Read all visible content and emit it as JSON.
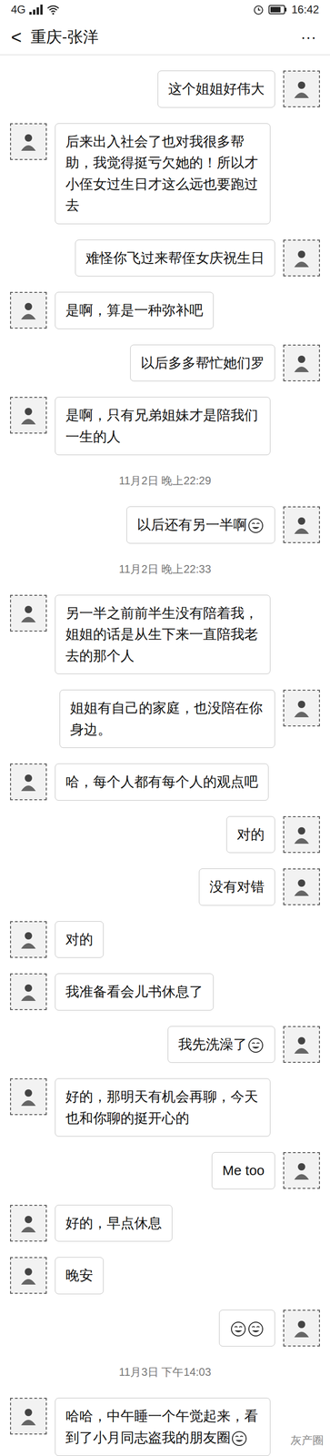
{
  "status_bar": {
    "network": "4G",
    "time": "16:42"
  },
  "header": {
    "back": "<",
    "title": "重庆-张洋",
    "more": "···"
  },
  "messages": [
    {
      "kind": "message",
      "side": "right",
      "text": "这个姐姐好伟大",
      "emojis": 0
    },
    {
      "kind": "message",
      "side": "left",
      "text": "后来出入社会了也对我很多帮助，我觉得挺亏欠她的！所以才小侄女过生日才这么远也要跑过去",
      "emojis": 0
    },
    {
      "kind": "message",
      "side": "right",
      "text": "难怪你飞过来帮侄女庆祝生日",
      "emojis": 0
    },
    {
      "kind": "message",
      "side": "left",
      "text": "是啊，算是一种弥补吧",
      "emojis": 0
    },
    {
      "kind": "message",
      "side": "right",
      "text": "以后多多帮忙她们罗",
      "emojis": 0
    },
    {
      "kind": "message",
      "side": "left",
      "text": "是啊，只有兄弟姐妹才是陪我们一生的人",
      "emojis": 0
    },
    {
      "kind": "time",
      "text": "11月2日 晚上22:29"
    },
    {
      "kind": "message",
      "side": "right",
      "text": "以后还有另一半啊",
      "emojis": 1
    },
    {
      "kind": "time",
      "text": "11月2日 晚上22:33"
    },
    {
      "kind": "message",
      "side": "left",
      "text": "另一半之前前半生没有陪着我，姐姐的话是从生下来一直陪我老去的那个人",
      "emojis": 0
    },
    {
      "kind": "message",
      "side": "right",
      "text": "姐姐有自己的家庭，也没陪在你身边。",
      "emojis": 0
    },
    {
      "kind": "message",
      "side": "left",
      "text": "哈，每个人都有每个人的观点吧",
      "emojis": 0
    },
    {
      "kind": "message",
      "side": "right",
      "text": "对的",
      "emojis": 0
    },
    {
      "kind": "message",
      "side": "right",
      "text": "没有对错",
      "emojis": 0
    },
    {
      "kind": "message",
      "side": "left",
      "text": "对的",
      "emojis": 0
    },
    {
      "kind": "message",
      "side": "left",
      "text": "我准备看会儿书休息了",
      "emojis": 0
    },
    {
      "kind": "message",
      "side": "right",
      "text": "我先洗澡了",
      "emojis": 1
    },
    {
      "kind": "message",
      "side": "left",
      "text": "好的，那明天有机会再聊，今天也和你聊的挺开心的",
      "emojis": 0
    },
    {
      "kind": "message",
      "side": "right",
      "text": "Me too",
      "emojis": 0
    },
    {
      "kind": "message",
      "side": "left",
      "text": "好的，早点休息",
      "emojis": 0
    },
    {
      "kind": "message",
      "side": "left",
      "text": "晚安",
      "emojis": 0
    },
    {
      "kind": "message",
      "side": "right",
      "text": "",
      "emojis": 2
    },
    {
      "kind": "time",
      "text": "11月3日 下午14:03"
    },
    {
      "kind": "message",
      "side": "left",
      "text": "哈哈，中午睡一个午觉起来，看到了小月同志盗我的朋友圈",
      "emojis": 1
    }
  ],
  "watermark": "灰产圈"
}
